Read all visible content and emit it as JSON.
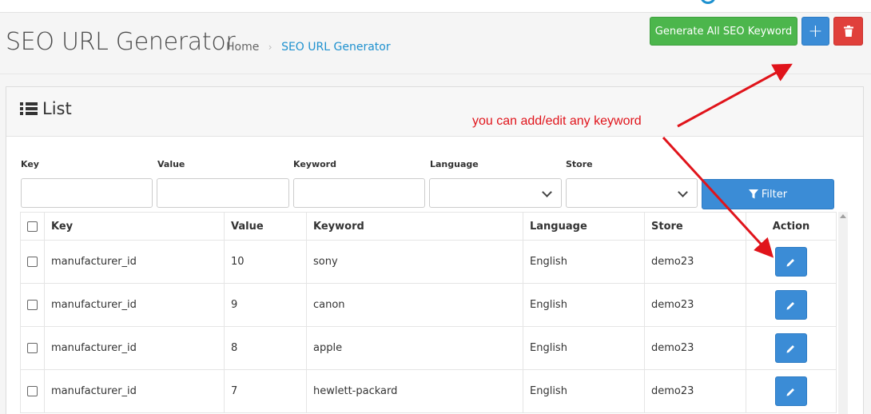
{
  "header": {
    "title": "SEO URL Generator",
    "breadcrumb": {
      "home": "Home",
      "separator": "›",
      "current": "SEO URL Generator"
    },
    "buttons": {
      "generate_label": "Generate All SEO Keyword",
      "add_label": "+",
      "delete_icon": "trash-icon"
    }
  },
  "panel": {
    "title": "List",
    "icon": "list-icon"
  },
  "annotation": {
    "text": "you can add/edit any keyword",
    "color": "#e0141b"
  },
  "filter": {
    "labels": {
      "key": "Key",
      "value": "Value",
      "keyword": "Keyword",
      "language": "Language",
      "store": "Store"
    },
    "values": {
      "key": "",
      "value": "",
      "keyword": "",
      "language": "",
      "store": ""
    },
    "button_label": "Filter",
    "button_icon": "filter-icon"
  },
  "table": {
    "columns": {
      "key": "Key",
      "value": "Value",
      "keyword": "Keyword",
      "language": "Language",
      "store": "Store",
      "action": "Action"
    },
    "rows": [
      {
        "key": "manufacturer_id",
        "value": "10",
        "keyword": "sony",
        "language": "English",
        "store": "demo23"
      },
      {
        "key": "manufacturer_id",
        "value": "9",
        "keyword": "canon",
        "language": "English",
        "store": "demo23"
      },
      {
        "key": "manufacturer_id",
        "value": "8",
        "keyword": "apple",
        "language": "English",
        "store": "demo23"
      },
      {
        "key": "manufacturer_id",
        "value": "7",
        "keyword": "hewlett-packard",
        "language": "English",
        "store": "demo23"
      }
    ],
    "row_action_icon": "pencil-icon"
  },
  "colors": {
    "primary": "#3b8cd6",
    "success": "#4cb64c",
    "danger": "#e0403b",
    "link": "#1e91cf"
  }
}
